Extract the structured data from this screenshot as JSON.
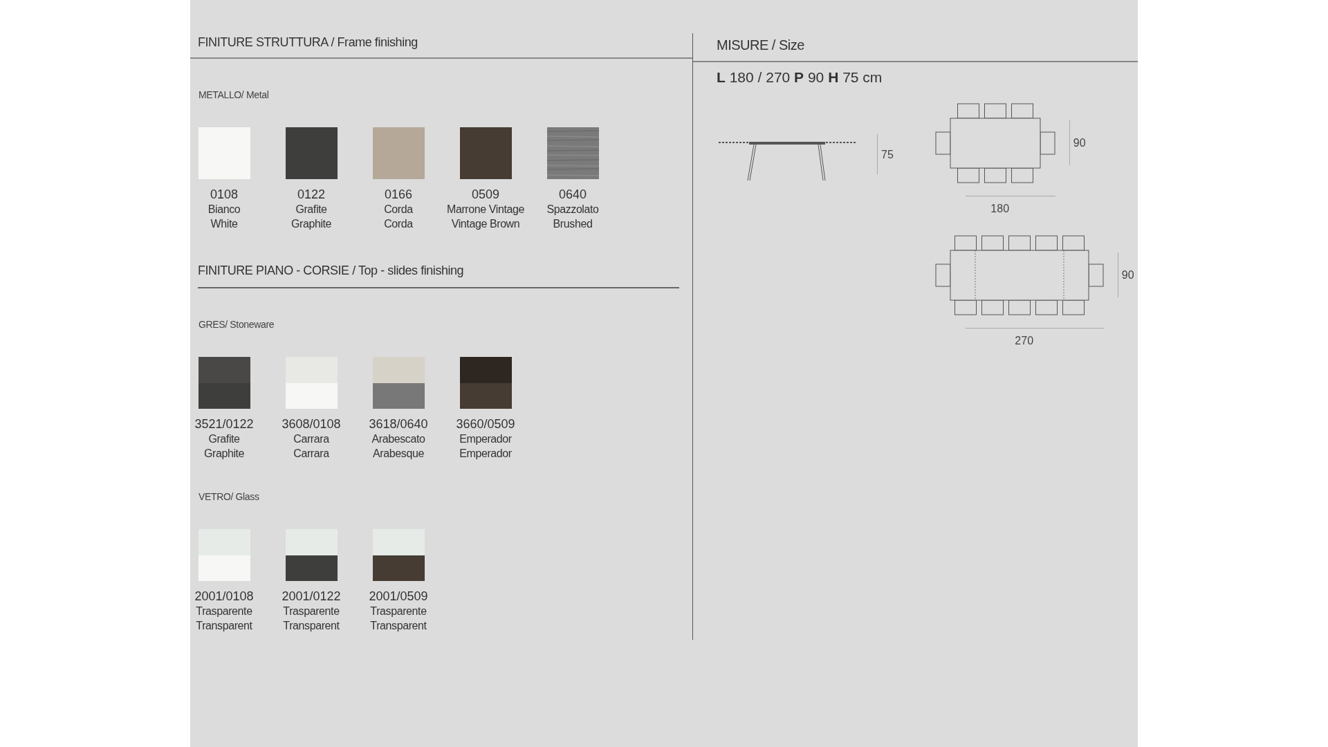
{
  "frame_finishing": {
    "title": "FINITURE STRUTTURA / Frame finishing",
    "groups": [
      {
        "title": "METALLO/ Metal",
        "swatches": [
          {
            "kind": "solid",
            "color": "#f7f7f5",
            "code": "0108",
            "name_it": "Bianco",
            "name_en": "White"
          },
          {
            "kind": "solid",
            "color": "#3e3e3c",
            "code": "0122",
            "name_it": "Grafite",
            "name_en": "Graphite"
          },
          {
            "kind": "solid",
            "color": "#b6a898",
            "code": "0166",
            "name_it": "Corda",
            "name_en": "Corda"
          },
          {
            "kind": "solid",
            "color": "#463c33",
            "code": "0509",
            "name_it": "Marrone Vintage",
            "name_en": "Vintage Brown"
          },
          {
            "kind": "brushed",
            "color": "#7a7a7a",
            "code": "0640",
            "name_it": "Spazzolato",
            "name_en": "Brushed"
          }
        ]
      }
    ]
  },
  "top_finishing": {
    "title": "FINITURE PIANO - CORSIE / Top - slides finishing",
    "groups": [
      {
        "title": "GRES/ Stoneware",
        "swatches": [
          {
            "kind": "split",
            "top": {
              "color": "#4a4846"
            },
            "color": "#3e3e3c",
            "code": "3521/0122",
            "name_it": "Grafite",
            "name_en": "Graphite"
          },
          {
            "kind": "split",
            "top": {
              "color": "#e8e8e4"
            },
            "color": "#f7f7f5",
            "code": "3608/0108",
            "name_it": "Carrara",
            "name_en": "Carrara"
          },
          {
            "kind": "split",
            "top": {
              "color": "#d6d2c8"
            },
            "color": "#787878",
            "code": "3618/0640",
            "name_it": "Arabescato",
            "name_en": "Arabesque"
          },
          {
            "kind": "split",
            "top": {
              "color": "#2e2620"
            },
            "color": "#463c33",
            "code": "3660/0509",
            "name_it": "Emperador",
            "name_en": "Emperador"
          }
        ]
      },
      {
        "title": "VETRO/ Glass",
        "swatches": [
          {
            "kind": "split",
            "top": {
              "color": "#e6ebe8"
            },
            "color": "#f7f7f5",
            "code": "2001/0108",
            "name_it": "Trasparente",
            "name_en": "Transparent"
          },
          {
            "kind": "split",
            "top": {
              "color": "#e6ebe8"
            },
            "color": "#3e3e3c",
            "code": "2001/0122",
            "name_it": "Trasparente",
            "name_en": "Transparent"
          },
          {
            "kind": "split",
            "top": {
              "color": "#e6ebe8"
            },
            "color": "#463c33",
            "code": "2001/0509",
            "name_it": "Trasparente",
            "name_en": "Transparent"
          }
        ]
      }
    ]
  },
  "size": {
    "title": "MISURE / Size",
    "dimensions": "**L** 180 / 270 **P** 90 **H** 75 cm",
    "side_view": {
      "height_label": "75"
    },
    "top_views": [
      {
        "kind": "closed",
        "depth_label": "90",
        "length_label": "180"
      },
      {
        "kind": "extended",
        "depth_label": "90",
        "length_label": "270"
      }
    ]
  }
}
